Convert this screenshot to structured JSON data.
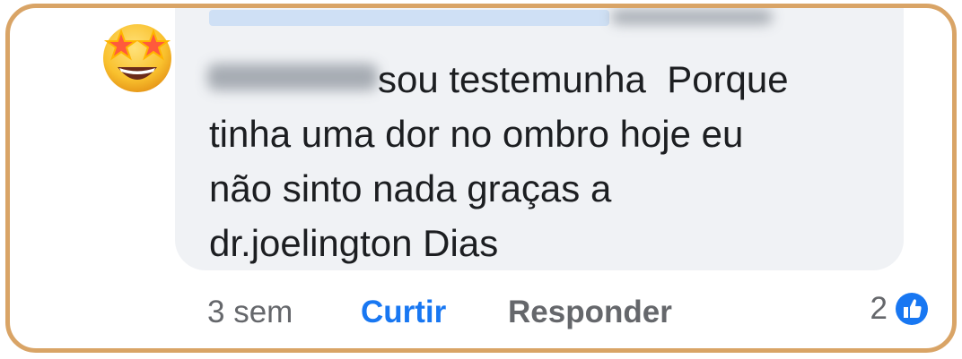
{
  "comment": {
    "author": "",
    "text_line1": "sou testemunha  Porque",
    "text_line2": "tinha uma dor no ombro hoje eu",
    "text_line3": "não sinto nada graças a",
    "text_line4": "dr.joelington Dias"
  },
  "actions": {
    "time": "3 sem",
    "like_label": "Curtir",
    "reply_label": "Responder"
  },
  "reactions": {
    "count": "2",
    "icon": "like-thumbs-up-icon",
    "icon_color": "#1877f2"
  },
  "avatar": {
    "emoji": "star-struck-face"
  },
  "colors": {
    "frame_border": "#d9a466",
    "bubble_bg": "#f0f2f5",
    "text": "#1c1e21",
    "muted": "#65676b",
    "accent": "#1877f2"
  }
}
